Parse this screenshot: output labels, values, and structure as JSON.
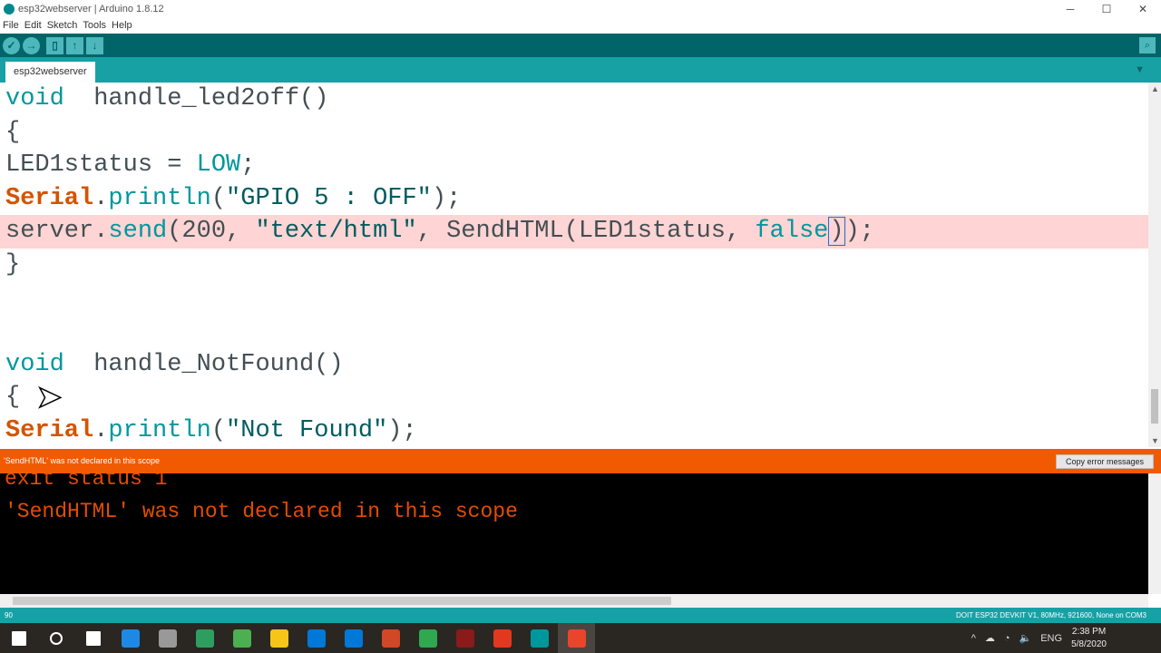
{
  "window": {
    "title": "esp32webserver | Arduino 1.8.12",
    "minimize": "─",
    "maximize": "☐",
    "close": "✕"
  },
  "menu": [
    "File",
    "Edit",
    "Sketch",
    "Tools",
    "Help"
  ],
  "toolbar": {
    "verify": "✓",
    "upload": "→",
    "new": "▯",
    "open": "↑",
    "save": "↓",
    "serial_monitor": "⌕"
  },
  "tab": {
    "label": "esp32webserver",
    "menu": "▼"
  },
  "code": [
    {
      "tokens": [
        [
          "kw",
          "void"
        ],
        [
          "",
          "  handle_led2off()"
        ]
      ]
    },
    {
      "tokens": [
        [
          "",
          "{"
        ]
      ]
    },
    {
      "tokens": [
        [
          "",
          "LED1status = "
        ],
        [
          "kw",
          "LOW"
        ],
        [
          "",
          ";"
        ]
      ]
    },
    {
      "tokens": [
        [
          "obj",
          "Serial"
        ],
        [
          "",
          "."
        ],
        [
          "fn",
          "println"
        ],
        [
          "",
          "("
        ],
        [
          "str",
          "\"GPIO 5 : OFF\""
        ],
        [
          "",
          ");"
        ]
      ]
    },
    {
      "highlight": true,
      "tokens": [
        [
          "",
          "server."
        ],
        [
          "fn",
          "send"
        ],
        [
          "",
          "(200, "
        ],
        [
          "str",
          "\"text/html\""
        ],
        [
          "",
          ", SendHTML(LED1status, "
        ],
        [
          "kw",
          "false"
        ],
        [
          "caret",
          ")"
        ],
        [
          "",
          ");"
        ]
      ]
    },
    {
      "tokens": [
        [
          "",
          "}"
        ]
      ]
    },
    {
      "tokens": []
    },
    {
      "tokens": []
    },
    {
      "tokens": [
        [
          "kw",
          "void"
        ],
        [
          "",
          "  handle_NotFound()"
        ]
      ]
    },
    {
      "tokens": [
        [
          "",
          "{"
        ]
      ]
    },
    {
      "tokens": [
        [
          "obj",
          "Serial"
        ],
        [
          "",
          "."
        ],
        [
          "fn",
          "println"
        ],
        [
          "",
          "("
        ],
        [
          "str",
          "\"Not Found\""
        ],
        [
          "",
          ");"
        ]
      ]
    }
  ],
  "error": {
    "message": "'SendHTML' was not declared in this scope",
    "copy_button": "Copy error messages"
  },
  "console": [
    "exit status 1",
    "'SendHTML' was not declared in this scope"
  ],
  "status": {
    "line": "90",
    "board": "DOIT ESP32 DEVKIT V1, 80MHz, 921600, None on COM3"
  },
  "taskbar": {
    "icons": [
      "windows-start",
      "cortana",
      "task-view",
      "edge",
      "app",
      "edge-beta",
      "chrome",
      "file-explorer",
      "store",
      "mail",
      "powerpoint",
      "camtasia",
      "winrar",
      "foxit",
      "arduino",
      "camtasia-recorder"
    ],
    "colors": [
      "#ffffff",
      "#ffffff",
      "#ffffff",
      "#1e88e5",
      "#999999",
      "#2e9e5e",
      "#4caf50",
      "#f5c518",
      "#0078d7",
      "#0078d7",
      "#d24726",
      "#2fa84f",
      "#8b1a1a",
      "#e2381f",
      "#00979c",
      "#e8452c"
    ],
    "tray": {
      "lang": "ENG",
      "time": "2:38 PM",
      "date": "5/8/2020"
    }
  }
}
